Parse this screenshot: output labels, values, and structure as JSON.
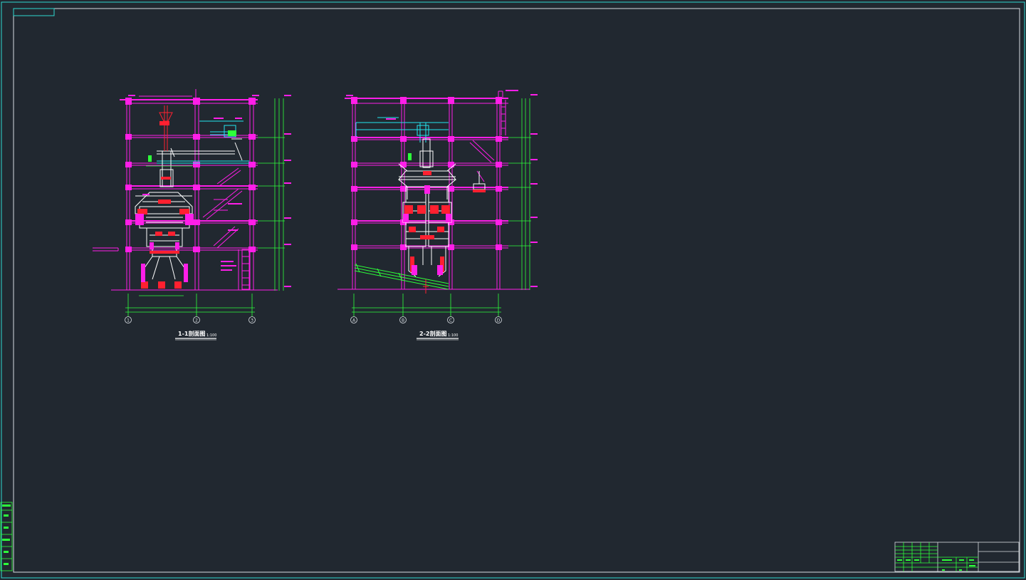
{
  "sections": [
    {
      "id": "section-1-1",
      "title": "1-1剖面图",
      "scale": "1:100",
      "axes": [
        "1",
        "2",
        "3"
      ]
    },
    {
      "id": "section-2-2",
      "title": "2-2剖面图",
      "scale": "1:100",
      "axes": [
        "A",
        "B",
        "C",
        "D"
      ]
    }
  ],
  "side_stamp_rows": [
    "",
    "",
    "",
    "",
    "",
    ""
  ],
  "colors": {
    "background": "#212830",
    "frame": "#d8dde2",
    "structure": "#ff1ee8",
    "equipment": "#ffffff",
    "red": "#ff2030",
    "dimension": "#2dff3a",
    "pipe": "#22e6f0"
  }
}
